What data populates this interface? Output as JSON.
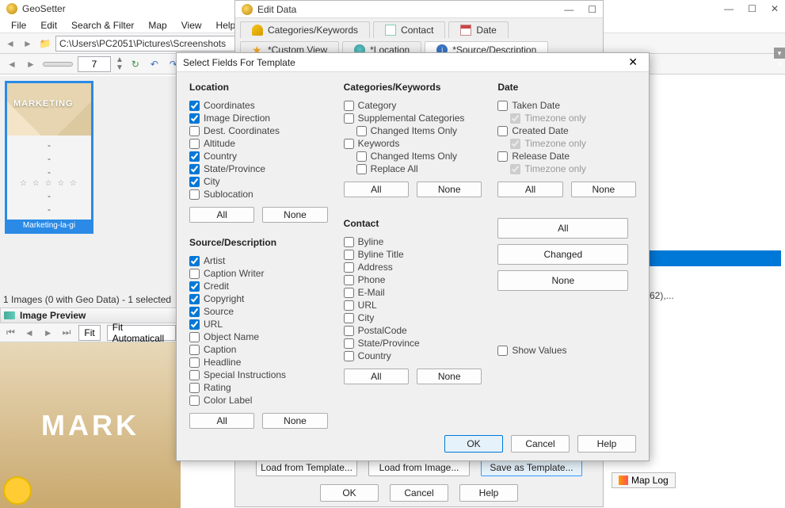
{
  "main": {
    "title": "GeoSetter",
    "menus": [
      "File",
      "Edit",
      "Search & Filter",
      "Map",
      "View",
      "Help"
    ],
    "path": "C:\\Users\\PC2051\\Pictures\\Screenshots",
    "spin_value": "7",
    "status": "1 Images (0 with Geo Data) - 1 selected",
    "thumb_caption": "Marketing-la-gi",
    "thumb_word": "MARKETING",
    "preview_fit": "Fit",
    "preview_fit_mode": "Fit Automaticall",
    "preview_title": "Image Preview",
    "preview_big_text": "MARK",
    "thumb_placeholder": "-",
    "stars": "☆ ☆ ☆ ☆ ☆"
  },
  "right": {
    "text": "62),...",
    "maplog": "Map Log"
  },
  "edit": {
    "title": "Edit Data",
    "tabs": {
      "categories": "Categories/Keywords",
      "contact": "Contact",
      "date": "Date",
      "custom": "*Custom View",
      "location": "*Location",
      "source": "*Source/Description"
    },
    "buttons": {
      "load_tpl": "Load from Template...",
      "load_img": "Load from Image...",
      "save_tpl": "Save as Template...",
      "ok": "OK",
      "cancel": "Cancel",
      "help": "Help"
    }
  },
  "dialog": {
    "title": "Select Fields For Template",
    "sections": {
      "location": {
        "title": "Location",
        "items": [
          {
            "label": "Coordinates",
            "checked": true
          },
          {
            "label": "Image Direction",
            "checked": true
          },
          {
            "label": "Dest. Coordinates",
            "checked": false
          },
          {
            "label": "Altitude",
            "checked": false
          },
          {
            "label": "Country",
            "checked": true
          },
          {
            "label": "State/Province",
            "checked": true
          },
          {
            "label": "City",
            "checked": true
          },
          {
            "label": "Sublocation",
            "checked": false
          }
        ]
      },
      "source": {
        "title": "Source/Description",
        "items": [
          {
            "label": "Artist",
            "checked": true
          },
          {
            "label": "Caption Writer",
            "checked": false
          },
          {
            "label": "Credit",
            "checked": true
          },
          {
            "label": "Copyright",
            "checked": true
          },
          {
            "label": "Source",
            "checked": true
          },
          {
            "label": "URL",
            "checked": true
          }
        ],
        "items2": [
          {
            "label": "Object Name",
            "checked": false
          },
          {
            "label": "Caption",
            "checked": false
          },
          {
            "label": "Headline",
            "checked": false
          },
          {
            "label": "Special Instructions",
            "checked": false
          },
          {
            "label": "Rating",
            "checked": false
          },
          {
            "label": "Color Label",
            "checked": false
          }
        ]
      },
      "categories": {
        "title": "Categories/Keywords",
        "items": [
          {
            "label": "Category",
            "checked": false
          },
          {
            "label": "Supplemental Categories",
            "checked": false
          },
          {
            "label": "Changed Items Only",
            "checked": false,
            "indent": true
          },
          {
            "label": "Keywords",
            "checked": false
          },
          {
            "label": "Changed Items Only",
            "checked": false,
            "indent": true
          },
          {
            "label": "Replace All",
            "checked": false,
            "indent": true
          }
        ]
      },
      "contact": {
        "title": "Contact",
        "items": [
          {
            "label": "Byline",
            "checked": false
          },
          {
            "label": "Byline Title",
            "checked": false
          },
          {
            "label": "Address",
            "checked": false
          },
          {
            "label": "Phone",
            "checked": false
          },
          {
            "label": "E-Mail",
            "checked": false
          },
          {
            "label": "URL",
            "checked": false
          },
          {
            "label": "City",
            "checked": false
          },
          {
            "label": "PostalCode",
            "checked": false
          },
          {
            "label": "State/Province",
            "checked": false
          },
          {
            "label": "Country",
            "checked": false
          }
        ]
      },
      "date": {
        "title": "Date",
        "items": [
          {
            "label": "Taken Date",
            "checked": false
          },
          {
            "label": "Timezone only",
            "checked": true,
            "indent": true,
            "disabled": true
          },
          {
            "label": "Created Date",
            "checked": false
          },
          {
            "label": "Timezone only",
            "checked": true,
            "indent": true,
            "disabled": true
          },
          {
            "label": "Release Date",
            "checked": false
          },
          {
            "label": "Timezone only",
            "checked": true,
            "indent": true,
            "disabled": true
          }
        ]
      }
    },
    "buttons": {
      "all": "All",
      "none": "None",
      "changed": "Changed",
      "ok": "OK",
      "cancel": "Cancel",
      "help": "Help",
      "show_values": "Show Values"
    }
  }
}
